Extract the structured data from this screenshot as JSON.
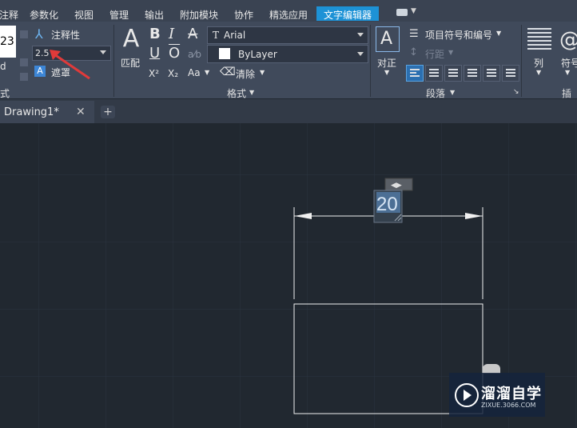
{
  "menu": {
    "items": [
      "注释",
      "参数化",
      "视图",
      "管理",
      "输出",
      "附加模块",
      "协作",
      "精选应用"
    ],
    "active": "文字编辑器"
  },
  "ribbon": {
    "style": {
      "height_value": "2.5",
      "text_height_partial": "23",
      "style_partial": "d",
      "annotative_label": "注释性",
      "mask_label": "遮罩",
      "panel_title_partial": "式"
    },
    "format": {
      "match_label": "匹配",
      "font": "Arial",
      "color": "ByLayer",
      "clear_label": "清除",
      "case_label": "Aa",
      "panel_title": "格式"
    },
    "paragraph": {
      "align_label": "对正",
      "bullets_label": "项目符号和编号",
      "line_spacing_label": "行距",
      "panel_title": "段落"
    },
    "insert": {
      "columns_label": "列",
      "symbol_label": "符号",
      "panel_title_partial": "插入"
    }
  },
  "tabs": {
    "drawing": "Drawing1*"
  },
  "canvas": {
    "dimension_text": "20"
  },
  "watermark": {
    "title": "溜溜自学",
    "url": "ZIXUE.3066.COM"
  }
}
